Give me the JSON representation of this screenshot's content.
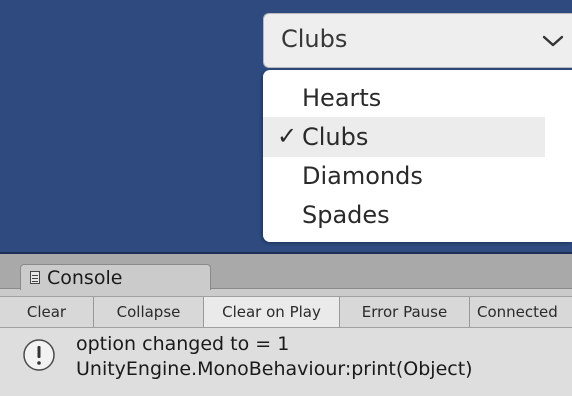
{
  "dropdown": {
    "selected_label": "Clubs",
    "arrow_icon": "chevron-down-icon",
    "options": [
      {
        "label": "Hearts",
        "checked": false
      },
      {
        "label": "Clubs",
        "checked": true
      },
      {
        "label": "Diamonds",
        "checked": false
      },
      {
        "label": "Spades",
        "checked": false
      }
    ],
    "check_mark": "✓"
  },
  "console": {
    "tab_label": "Console",
    "tab_icon": "console-icon",
    "toolbar": {
      "clear": "Clear",
      "collapse": "Collapse",
      "clear_on_play": "Clear on Play",
      "error_pause": "Error Pause",
      "connected": "Connected"
    },
    "log": {
      "icon": "info-icon",
      "line1": "option changed to = 1",
      "line2": "UnityEngine.MonoBehaviour:print(Object)"
    }
  },
  "colors": {
    "scene_background": "#2e4a7e",
    "menu_highlight": "#ececec",
    "panel_gray": "#cbcbcb"
  }
}
